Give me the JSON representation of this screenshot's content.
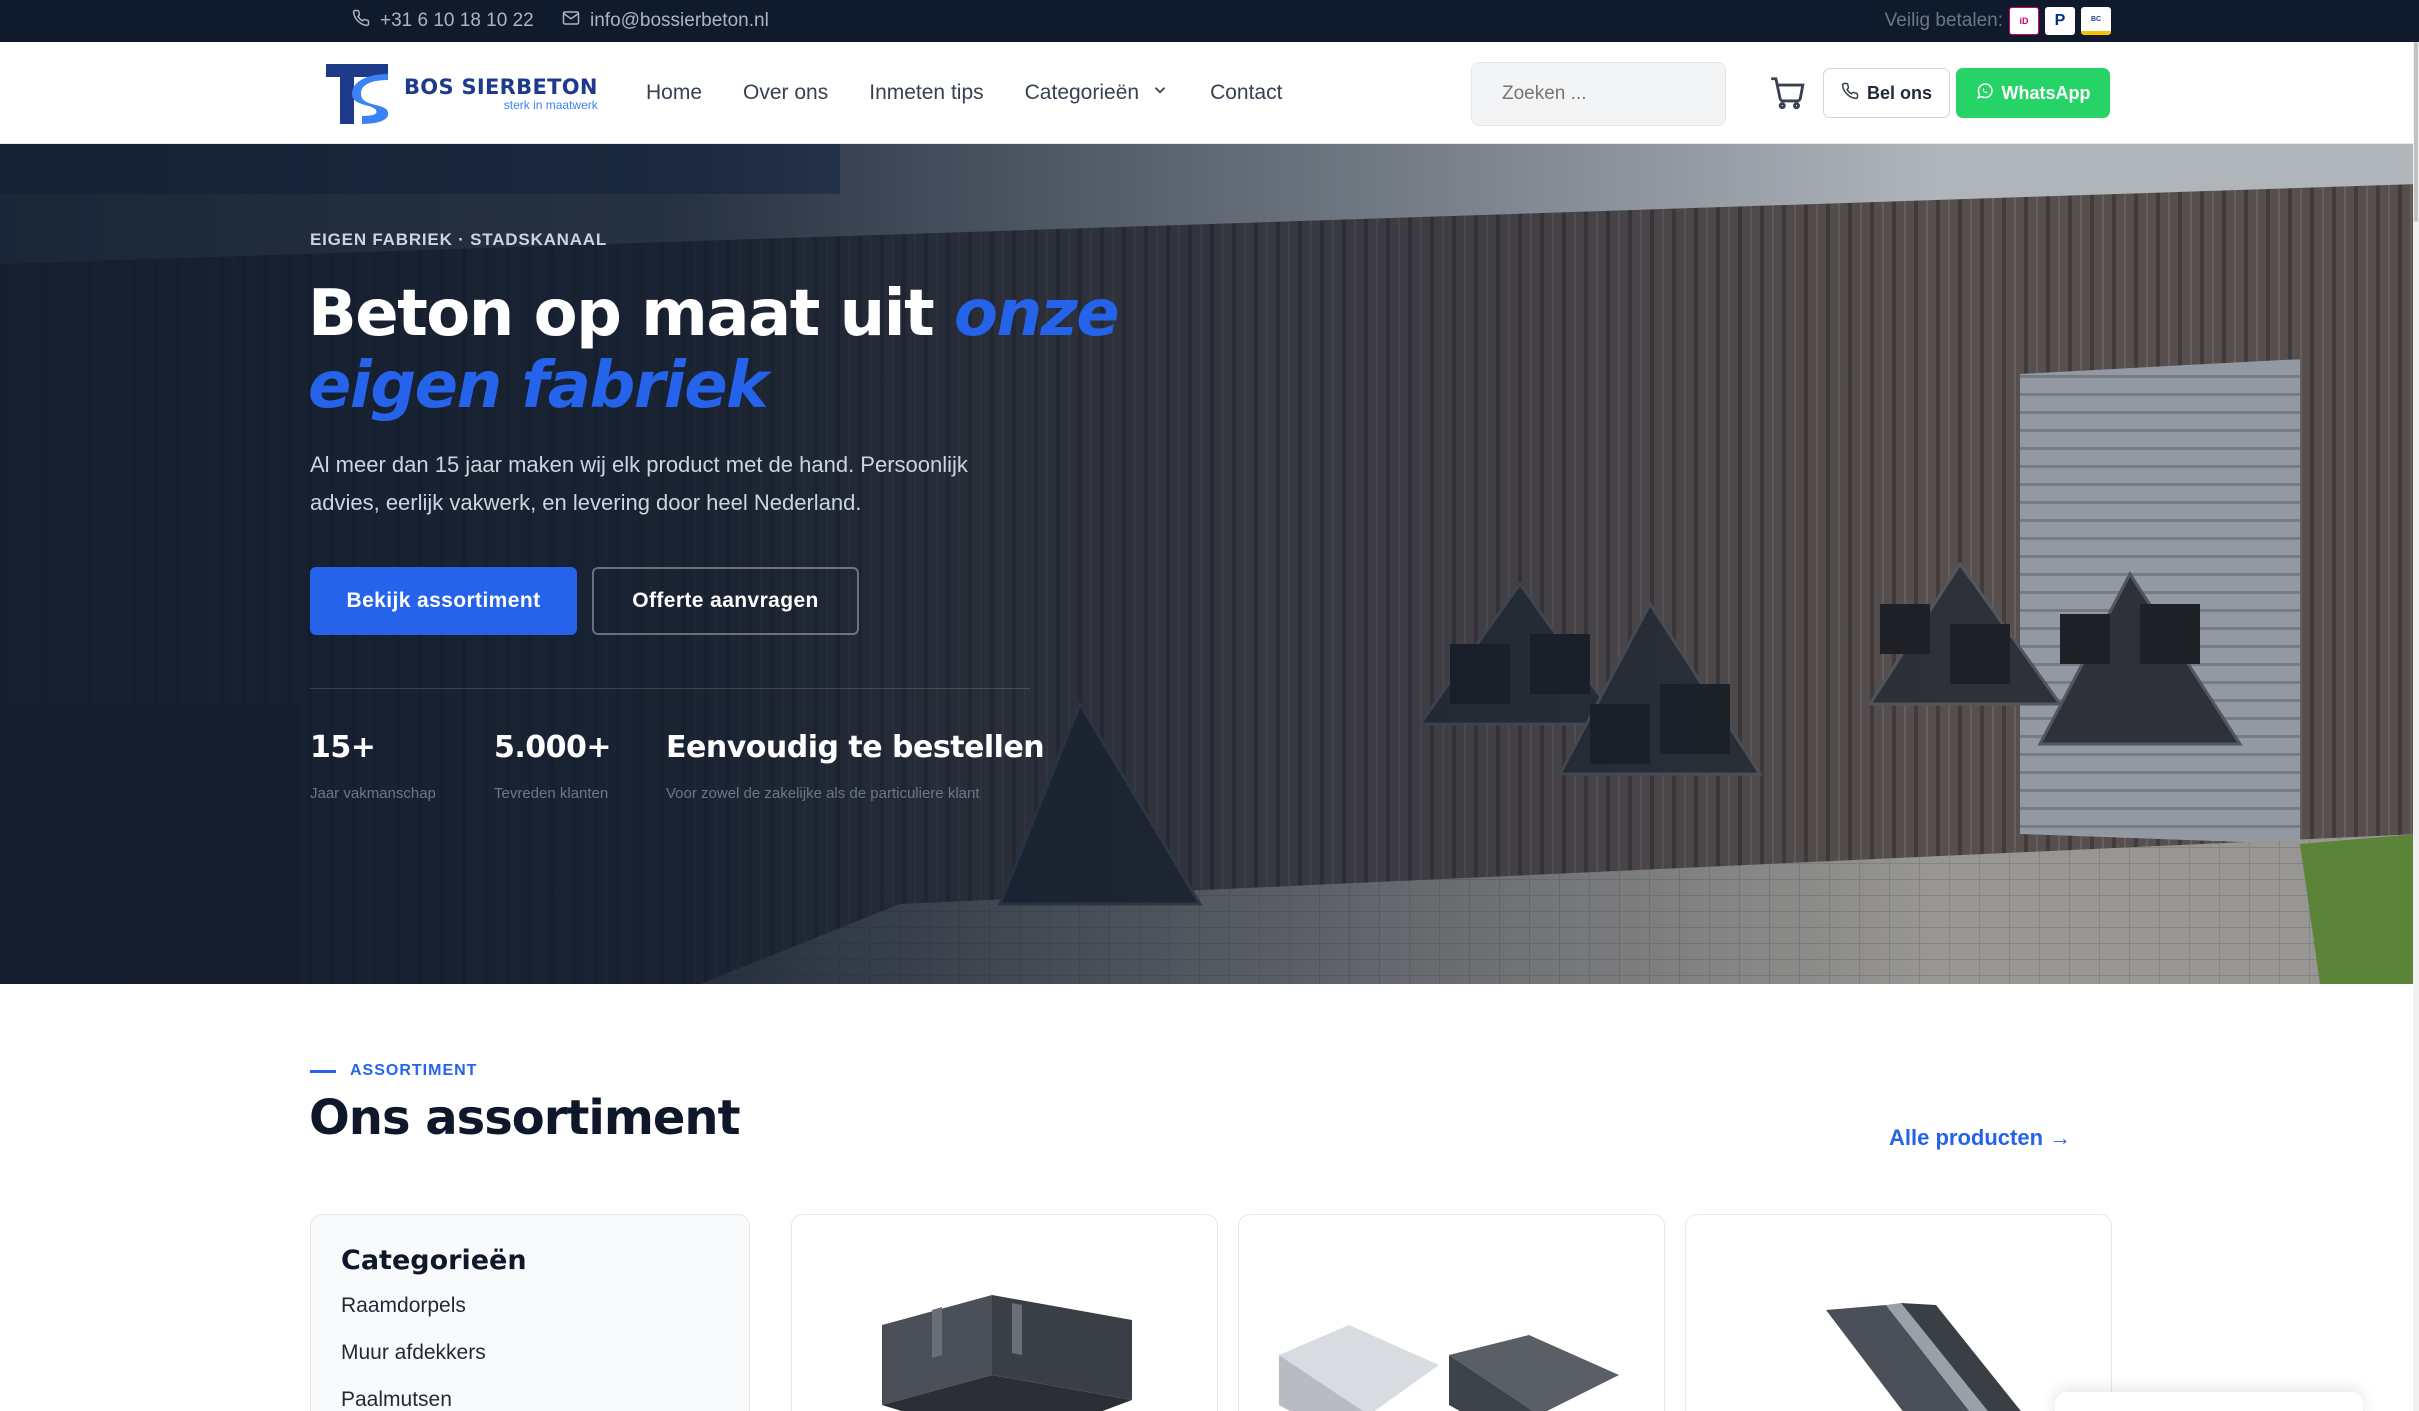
{
  "topbar": {
    "phone": "+31 6 10 18 10 22",
    "email": "info@bossierbeton.nl",
    "pay_label": "Veilig betalen:",
    "pay_methods": [
      "iDEAL",
      "PayPal",
      "Bancontact"
    ]
  },
  "header": {
    "brand": "BOS SIERBETON",
    "tagline": "sterk in maatwerk",
    "nav": [
      "Home",
      "Over ons",
      "Inmeten tips",
      "Categorieën",
      "Contact"
    ],
    "search_placeholder": "Zoeken ...",
    "call_label": "Bel ons",
    "whatsapp_label": "WhatsApp"
  },
  "hero": {
    "eyebrow": "EIGEN FABRIEK · STADSKANAAL",
    "title_plain": "Beton op maat uit ",
    "title_accent": "onze eigen fabriek",
    "subtitle": "Al meer dan 15 jaar maken wij elk product met de hand. Persoonlijk advies, eerlijk vakwerk, en levering door heel Nederland.",
    "primary_cta": "Bekijk assortiment",
    "secondary_cta": "Offerte aanvragen",
    "stats": [
      {
        "value": "15+",
        "label": "Jaar vakmanschap"
      },
      {
        "value": "5.000+",
        "label": "Tevreden klanten"
      },
      {
        "value": "Eenvoudig te bestellen",
        "label": "Voor zowel de zakelijke als de particuliere klant"
      }
    ]
  },
  "assortiment": {
    "eyebrow": "ASSORTIMENT",
    "title": "Ons assortiment",
    "all_link": "Alle producten →",
    "categories_title": "Categorieën",
    "categories": [
      "Raamdorpels",
      "Muur afdekkers",
      "Paalmutsen"
    ]
  },
  "colors": {
    "accent": "#2563eb",
    "dark": "#0f1b2d",
    "whatsapp": "#25d366"
  }
}
